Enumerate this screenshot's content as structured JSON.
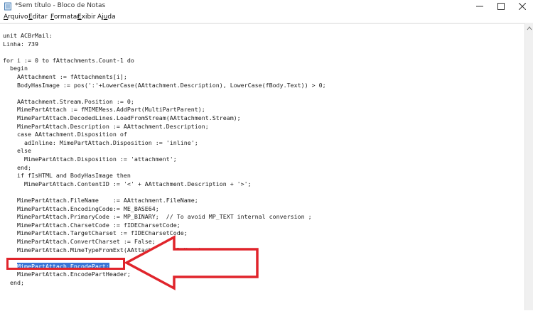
{
  "window": {
    "title": "*Sem título - Bloco de Notas",
    "minimize_icon": "minimize-icon",
    "maximize_icon": "maximize-icon",
    "close_icon": "close-icon"
  },
  "menu": {
    "items": [
      {
        "pre": "",
        "key": "A",
        "post": "rquivo"
      },
      {
        "pre": "",
        "key": "E",
        "post": "ditar"
      },
      {
        "pre": "",
        "key": "F",
        "post": "ormatar"
      },
      {
        "pre": "",
        "key": "E",
        "post": "xibir"
      },
      {
        "pre": "Aj",
        "key": "u",
        "post": "da"
      }
    ]
  },
  "editor": {
    "lines": [
      "unit ACBrMail:",
      "Linha: 739",
      "",
      "for i := 0 to fAttachments.Count-1 do",
      "  begin",
      "    AAttachment := fAttachments[i];",
      "    BodyHasImage := pos(':'+LowerCase(AAttachment.Description), LowerCase(fBody.Text)) > 0;",
      "",
      "    AAttachment.Stream.Position := 0;",
      "    MimePartAttach := fMIMEMess.AddPart(MultiPartParent);",
      "    MimePartAttach.DecodedLines.LoadFromStream(AAttachment.Stream);",
      "    MimePartAttach.Description := AAttachment.Description;",
      "    case AAttachment.Disposition of",
      "      adInline: MimePartAttach.Disposition := 'inline';",
      "    else",
      "      MimePartAttach.Disposition := 'attachment';",
      "    end;",
      "    if fIsHTML and BodyHasImage then",
      "      MimePartAttach.ContentID := '<' + AAttachment.Description + '>';",
      "",
      "    MimePartAttach.FileName    := AAttachment.FileName;",
      "    MimePartAttach.EncodingCode:= ME_BASE64;",
      "    MimePartAttach.PrimaryCode := MP_BINARY;  // To avoid MP_TEXT internal conversion ;",
      "    MimePartAttach.CharsetCode := fIDECharsetCode;",
      "    MimePartAttach.TargetCharset := fIDECharsetCode;",
      "    MimePartAttach.ConvertCharset := False;",
      "    MimePartAttach.MimeTypeFromExt(AAttachment.FileName);",
      "",
      "    MimePartAttach.EncodePart;",
      "    MimePartAttach.EncodePartHeader;",
      "  end;"
    ],
    "selected_line_index": 28,
    "selection_color": "#3875d7"
  },
  "annotation": {
    "color": "#e0242b",
    "shape": "arrow-pointing-left-with-box"
  }
}
